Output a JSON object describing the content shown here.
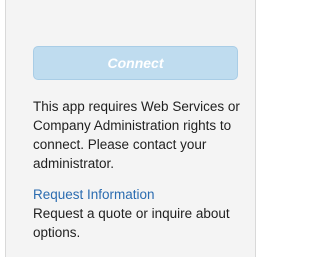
{
  "connect": {
    "label": "Connect",
    "state": "disabled"
  },
  "notice": {
    "text": "This app requires Web Services or Company Administration rights to connect. Please contact your administrator."
  },
  "request": {
    "link_label": "Request Information",
    "description": "Request a quote or inquire about options."
  }
}
